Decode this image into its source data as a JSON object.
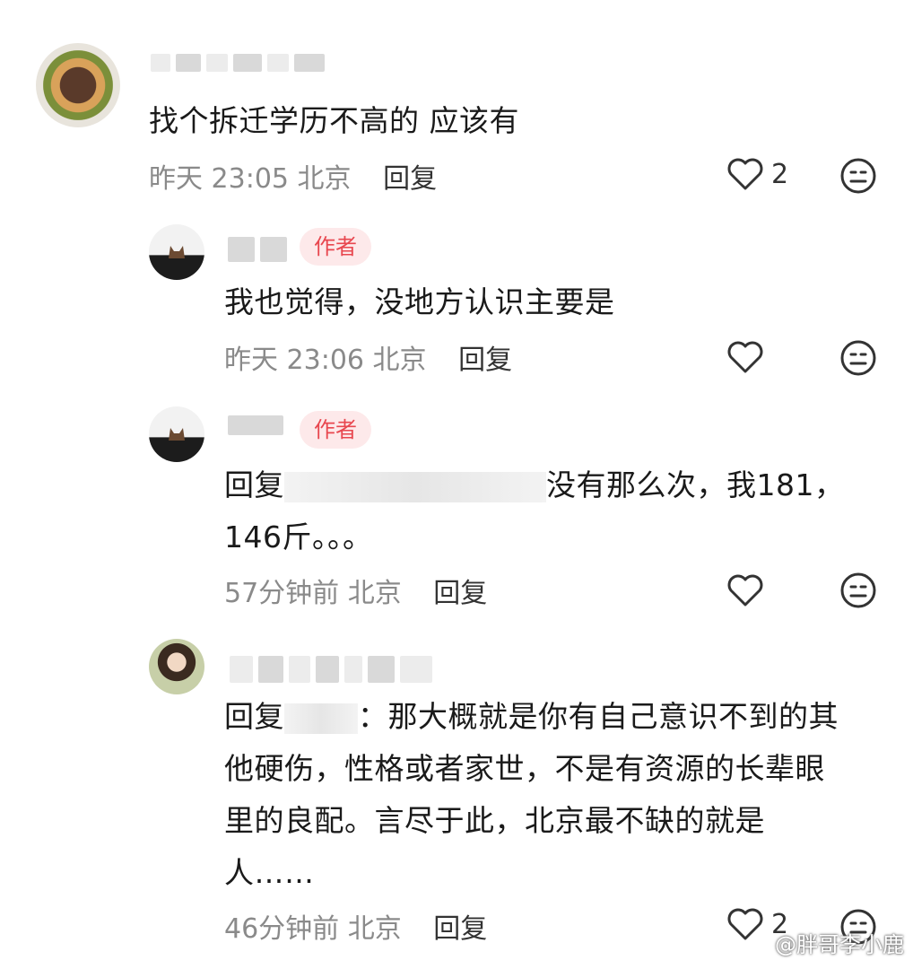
{
  "comments": [
    {
      "text": "找个拆迁学历不高的 应该有",
      "time": "昨天 23:05",
      "location": "北京",
      "reply_label": "回复",
      "likes": "2"
    },
    {
      "author_tag": "作者",
      "text": "我也觉得，没地方认识主要是",
      "time": "昨天 23:06",
      "location": "北京",
      "reply_label": "回复"
    },
    {
      "author_tag": "作者",
      "reply_prefix": "回复",
      "text_line1": "没有那么次，我181，",
      "text_line2": "146斤。。。",
      "time": "57分钟前",
      "location": "北京",
      "reply_label": "回复"
    },
    {
      "reply_prefix": "回复",
      "text_line1": "：那大概就是你有自己意识不到的其",
      "text_line2": "他硬伤，性格或者家世，不是有资源的长辈眼",
      "text_line3": "里的良配。言尽于此，北京最不缺的就是",
      "text_line4": "人……",
      "time": "46分钟前",
      "location": "北京",
      "reply_label": "回复",
      "likes": "2"
    }
  ],
  "icons": {
    "like": "heart-outline-icon",
    "dislike": "neutral-face-icon"
  },
  "watermark": {
    "text": "@胖哥李小鹿"
  },
  "colors": {
    "author_tag_bg": "#fde9ea",
    "author_tag_text": "#e8474f",
    "meta_text": "#8a8a8a"
  }
}
